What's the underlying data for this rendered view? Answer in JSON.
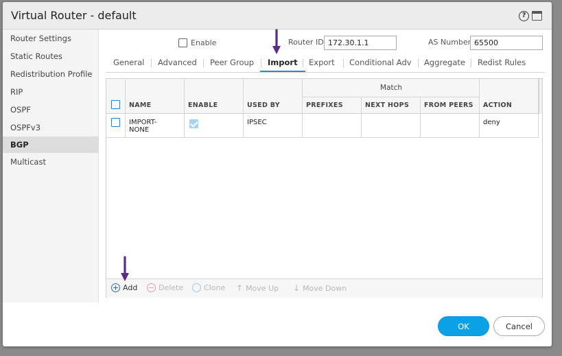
{
  "window": {
    "title": "Virtual Router - default"
  },
  "sidebar": {
    "items": [
      {
        "label": "Router Settings"
      },
      {
        "label": "Static Routes"
      },
      {
        "label": "Redistribution Profile"
      },
      {
        "label": "RIP"
      },
      {
        "label": "OSPF"
      },
      {
        "label": "OSPFv3"
      },
      {
        "label": "BGP",
        "active": true
      },
      {
        "label": "Multicast"
      }
    ]
  },
  "bgp": {
    "enable_label": "Enable",
    "enable_checked": false,
    "router_id_label": "Router ID",
    "router_id_value": "172.30.1.1",
    "as_number_label": "AS Number",
    "as_number_value": "65500"
  },
  "tabs": [
    {
      "label": "General"
    },
    {
      "label": "Advanced"
    },
    {
      "label": "Peer Group"
    },
    {
      "label": "Import",
      "active": true
    },
    {
      "label": "Export"
    },
    {
      "label": "Conditional Adv"
    },
    {
      "label": "Aggregate"
    },
    {
      "label": "Redist Rules"
    }
  ],
  "table": {
    "group_header": "Match",
    "columns": {
      "name": "NAME",
      "enable": "ENABLE",
      "used_by": "USED BY",
      "prefixes": "PREFIXES",
      "next_hops": "NEXT HOPS",
      "from_peers": "FROM PEERS",
      "action": "ACTION"
    },
    "rows": [
      {
        "name_line1": "IMPORT-",
        "name_line2": "NONE",
        "enabled": true,
        "used_by": "IPSEC",
        "prefixes": "",
        "next_hops": "",
        "from_peers": "",
        "action": "deny"
      }
    ]
  },
  "toolbar": {
    "add": "Add",
    "delete": "Delete",
    "clone": "Clone",
    "move_up": "Move Up",
    "move_down": "Move Down"
  },
  "footer": {
    "ok": "OK",
    "cancel": "Cancel"
  },
  "colors": {
    "accent": "#0aa1e6",
    "annotation_arrow": "#5b2a86",
    "tab_underline": "#2a8ad4"
  }
}
